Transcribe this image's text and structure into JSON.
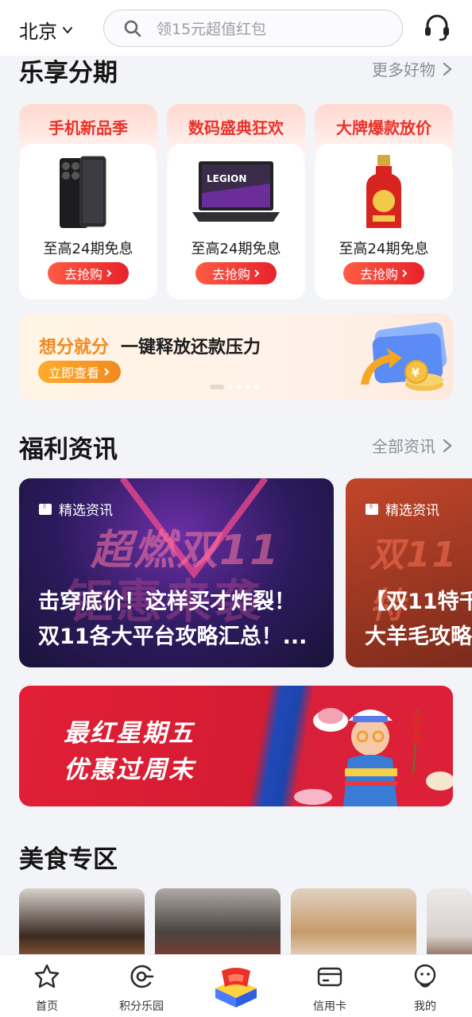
{
  "header": {
    "city": "北京",
    "search_placeholder": "领15元超值红包",
    "icons": [
      "chevron-down-icon",
      "search-icon",
      "headset-icon"
    ]
  },
  "installment": {
    "title": "乐享分期",
    "more": "更多好物",
    "cards": [
      {
        "title": "手机新品季",
        "subtitle": "至高24期免息",
        "button": "去抢购",
        "product": "phone"
      },
      {
        "title": "数码盛典狂欢",
        "subtitle": "至高24期免息",
        "button": "去抢购",
        "product": "laptop"
      },
      {
        "title": "大牌爆款放价",
        "subtitle": "至高24期免息",
        "button": "去抢购",
        "product": "liquor"
      }
    ]
  },
  "banner": {
    "highlight": "想分就分",
    "text": "一键释放还款压力",
    "button": "立即查看",
    "dots": 5,
    "active_dot": 0
  },
  "news": {
    "title": "福利资讯",
    "more": "全部资讯",
    "cards": [
      {
        "tag": "精选资讯",
        "headline_1": "击穿底价！这样买才炸裂！",
        "headline_2": "双11各大平台攻略汇总！...",
        "bg_text_1": "超燃双11",
        "bg_text_2": "钜惠来袭"
      },
      {
        "tag": "精选资讯",
        "headline_1": "【双11特千",
        "headline_2": "大羊毛攻略",
        "bg_text_1": "双11特"
      }
    ]
  },
  "friday_banner": {
    "line1": "最红星期五",
    "line2": "优惠过周末"
  },
  "food": {
    "title": "美食专区"
  },
  "bottom_nav": [
    {
      "label": "首页",
      "icon": "star-icon"
    },
    {
      "label": "积分乐园",
      "icon": "points-icon"
    },
    {
      "label": "",
      "icon": "center-logo-icon"
    },
    {
      "label": "信用卡",
      "icon": "credit-card-icon"
    },
    {
      "label": "我的",
      "icon": "profile-icon"
    }
  ],
  "colors": {
    "accent_red": "#e8322b",
    "accent_orange": "#f08a1f",
    "background": "#f3f4f8"
  }
}
